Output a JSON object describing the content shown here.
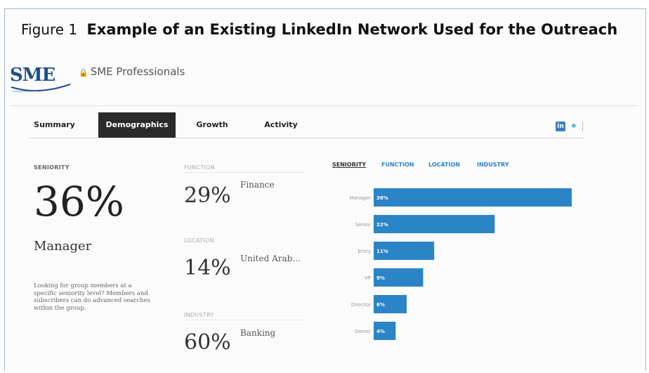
{
  "figure": {
    "number": "Figure 1",
    "title": "Example of an Existing LinkedIn Network Used for the Outreach"
  },
  "header": {
    "logo_text": "SME",
    "group_name": "SME Professionals"
  },
  "tabs": [
    {
      "label": "Summary",
      "active": false
    },
    {
      "label": "Demographics",
      "active": true
    },
    {
      "label": "Growth",
      "active": false
    },
    {
      "label": "Activity",
      "active": false
    }
  ],
  "social": {
    "linkedin_icon": "linkedin-icon",
    "twitter_icon": "twitter-icon"
  },
  "seniority_panel": {
    "label": "SENIORITY",
    "percent": "36%",
    "caption": "Manager",
    "description": "Looking for group members at a specific seniority level? Members and subscribers can do advanced searches within the group."
  },
  "stats": [
    {
      "label": "FUNCTION",
      "percent": "29%",
      "name": "Finance"
    },
    {
      "label": "LOCATION",
      "percent": "14%",
      "name": "United Arab..."
    },
    {
      "label": "INDUSTRY",
      "percent": "60%",
      "name": "Banking"
    }
  ],
  "bar_tabs": [
    {
      "label": "SENIORITY",
      "active": true
    },
    {
      "label": "FUNCTION",
      "active": false
    },
    {
      "label": "LOCATION",
      "active": false
    },
    {
      "label": "INDUSTRY",
      "active": false
    }
  ],
  "colors": {
    "bar": "#2a84c6",
    "tab_active_bg": "#2a2a2a",
    "link": "#2a84c6"
  },
  "chart_data": {
    "type": "bar",
    "orientation": "horizontal",
    "categories": [
      "Manager",
      "Senior",
      "Entry",
      "VP",
      "Director",
      "Owner"
    ],
    "values": [
      36,
      22,
      11,
      9,
      6,
      4
    ],
    "value_labels": [
      "36%",
      "22%",
      "11%",
      "9%",
      "6%",
      "4%"
    ],
    "xlim": [
      0,
      36
    ]
  }
}
